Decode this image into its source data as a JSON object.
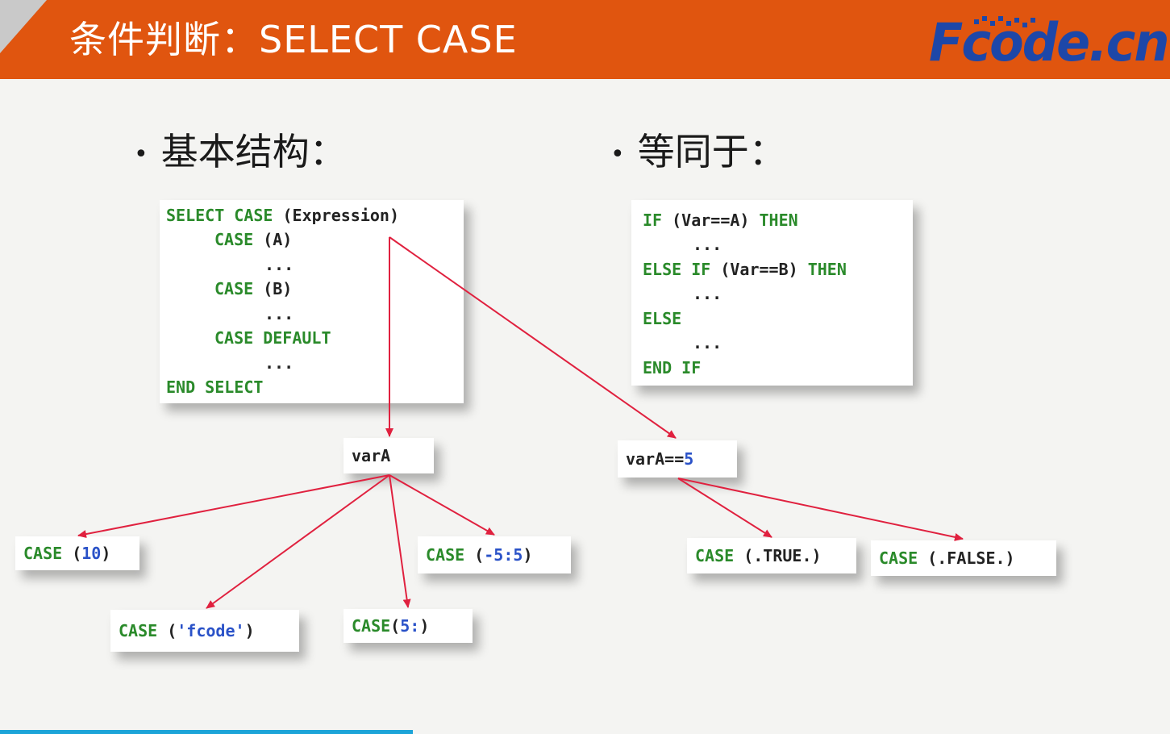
{
  "header": {
    "title": "条件判断：SELECT CASE",
    "logo_text": "Fcode.cn"
  },
  "bullets": {
    "basic": "基本结构：",
    "equivalent": "等同于："
  },
  "select_block": [
    {
      "kw": "SELECT CASE",
      "rest": " (Expression)"
    },
    {
      "kw": "CASE",
      "rest": " (A)"
    },
    {
      "kw": "",
      "rest": "..."
    },
    {
      "kw": "CASE",
      "rest": " (B)"
    },
    {
      "kw": "",
      "rest": "..."
    },
    {
      "kw": "CASE DEFAULT",
      "rest": ""
    },
    {
      "kw": "",
      "rest": "..."
    },
    {
      "kw": "END SELECT",
      "rest": ""
    }
  ],
  "if_block": [
    {
      "kw": "IF",
      "rest": " (Var==A) ",
      "kw2": "THEN"
    },
    {
      "kw": "",
      "rest": "...",
      "kw2": ""
    },
    {
      "kw": "ELSE IF",
      "rest": " (Var==B) ",
      "kw2": "THEN"
    },
    {
      "kw": "",
      "rest": "...",
      "kw2": ""
    },
    {
      "kw": "ELSE",
      "rest": "",
      "kw2": ""
    },
    {
      "kw": "",
      "rest": "...",
      "kw2": ""
    },
    {
      "kw": "END IF",
      "rest": "",
      "kw2": ""
    }
  ],
  "nodes": {
    "varA": "varA",
    "varA_eq": {
      "text": "varA==",
      "num": "5"
    },
    "case10": {
      "kw": "CASE",
      "open": " (",
      "val": "10",
      "close": ")"
    },
    "case_fcode": {
      "kw": "CASE",
      "open": " (",
      "val": "'fcode'",
      "close": ")"
    },
    "case5": {
      "kw": "CASE",
      "open": "(",
      "val": "5:",
      "close": ")"
    },
    "case_range": {
      "kw": "CASE",
      "open": " (",
      "val": "-5:5",
      "close": ")"
    },
    "case_true": {
      "kw": "CASE",
      "rest": " (.TRUE.)"
    },
    "case_false": {
      "kw": "CASE",
      "rest": " (.FALSE.)"
    }
  },
  "progress": 0.353,
  "colors": {
    "header": "#e0550f",
    "keyword": "#2a8a2a",
    "number": "#2a52c8",
    "arrow": "#e0213f",
    "logo": "#1d47a8",
    "progress": "#1ca4d8"
  }
}
